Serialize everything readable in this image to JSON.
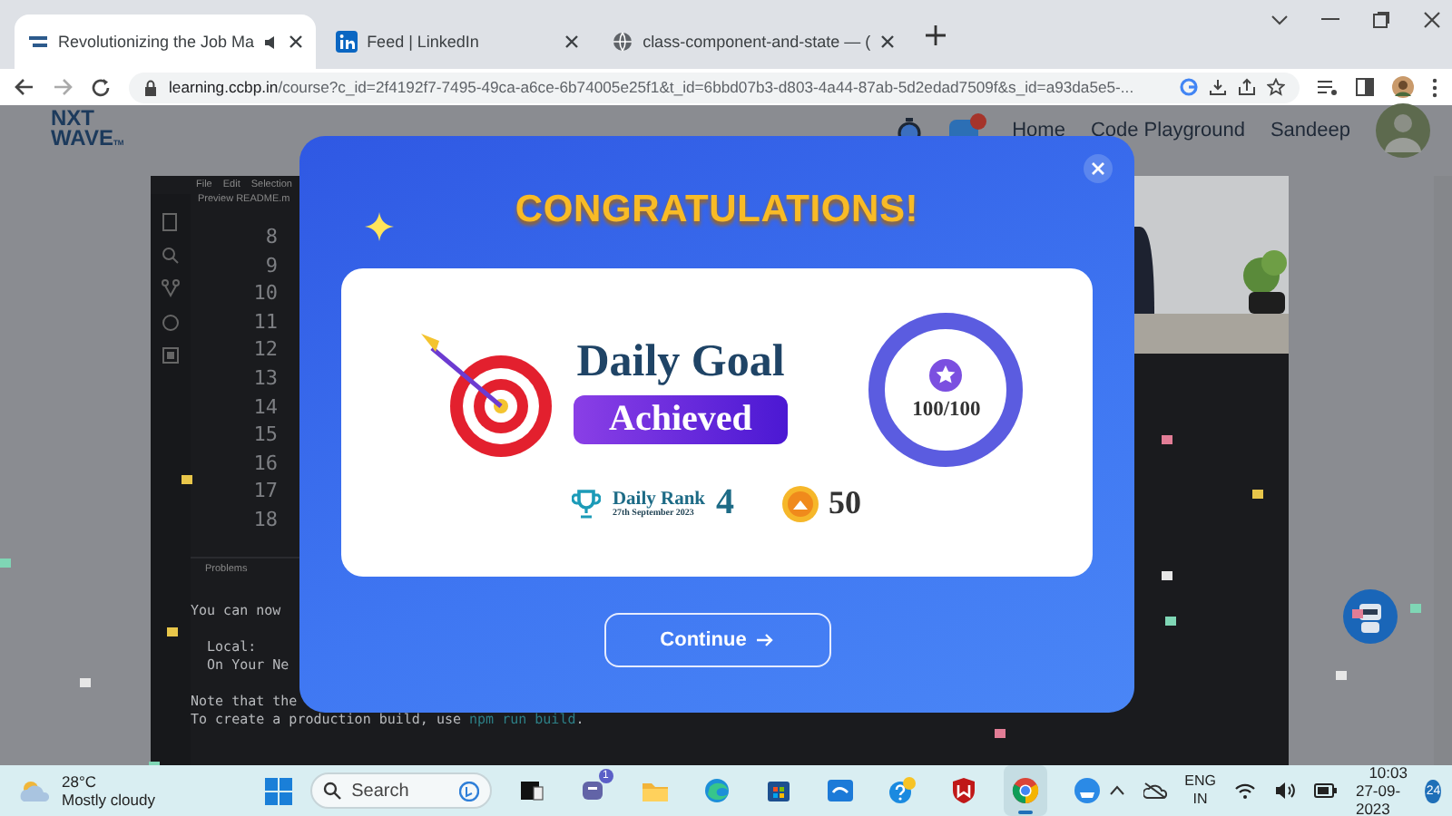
{
  "browser": {
    "tabs": [
      {
        "title": "Revolutionizing the Job Ma",
        "selected": true,
        "kind": "nxtwave",
        "muted": true
      },
      {
        "title": "Feed | LinkedIn",
        "selected": false,
        "kind": "linkedin",
        "muted": false
      },
      {
        "title": "class-component-and-state — (",
        "selected": false,
        "kind": "globe",
        "muted": false
      }
    ],
    "url_host": "learning.ccbp.in",
    "url_rest": "/course?c_id=2f4192f7-7495-49ca-a6ce-6b74005e25f1&t_id=6bbd07b3-d803-4a44-87ab-5d2edad7509f&s_id=a93da5e5-..."
  },
  "header": {
    "logo": [
      "NXT",
      "WAVE"
    ],
    "logo_mark": "TM",
    "nav": [
      "Home",
      "Code Playground"
    ],
    "user": "Sandeep"
  },
  "editor": {
    "menu": [
      "File",
      "Edit",
      "Selection"
    ],
    "tab": "Preview README.m",
    "line_numbers": [
      "8",
      "9",
      "10",
      "11",
      "12",
      "13",
      "14",
      "15",
      "16",
      "17",
      "18"
    ],
    "panel_tab": "Problems",
    "terminal": [
      {
        "lines": [
          {
            "text": "You can now"
          }
        ]
      },
      {
        "lines": [
          {
            "text": "  Local:"
          },
          {
            "text": "  On Your Ne"
          }
        ]
      },
      {
        "lines": [
          {
            "text": "Note that the"
          },
          {
            "text": "To create a production build, use ",
            "command": "npm run build",
            "after": "."
          }
        ]
      }
    ]
  },
  "modal": {
    "title": "CONGRATULATIONS!",
    "heading": "Daily Goal",
    "badge": "Achieved",
    "progress": {
      "text": "100/100",
      "level": 1
    },
    "rank_label": "Daily Rank",
    "rank_date": "27th September 2023",
    "rank": "4",
    "coins": "50",
    "button": "Continue"
  },
  "taskbar": {
    "temperature": "28°C",
    "weather": "Mostly cloudy",
    "search": {
      "placeholder": "Search"
    },
    "apps": [
      {
        "kind": "taskview",
        "selected": false
      },
      {
        "kind": "teams",
        "selected": false,
        "badge": "1"
      },
      {
        "kind": "folder",
        "selected": false
      },
      {
        "kind": "edge",
        "selected": false
      },
      {
        "kind": "store",
        "selected": false
      },
      {
        "kind": "blue-app",
        "selected": false
      },
      {
        "kind": "help",
        "selected": false
      },
      {
        "kind": "shield",
        "selected": false
      },
      {
        "kind": "chrome",
        "selected": true
      },
      {
        "kind": "round-app",
        "selected": false
      }
    ],
    "language": [
      "ENG",
      "IN"
    ],
    "time": "10:03",
    "date": "27-09-2023",
    "notifications": "24"
  }
}
